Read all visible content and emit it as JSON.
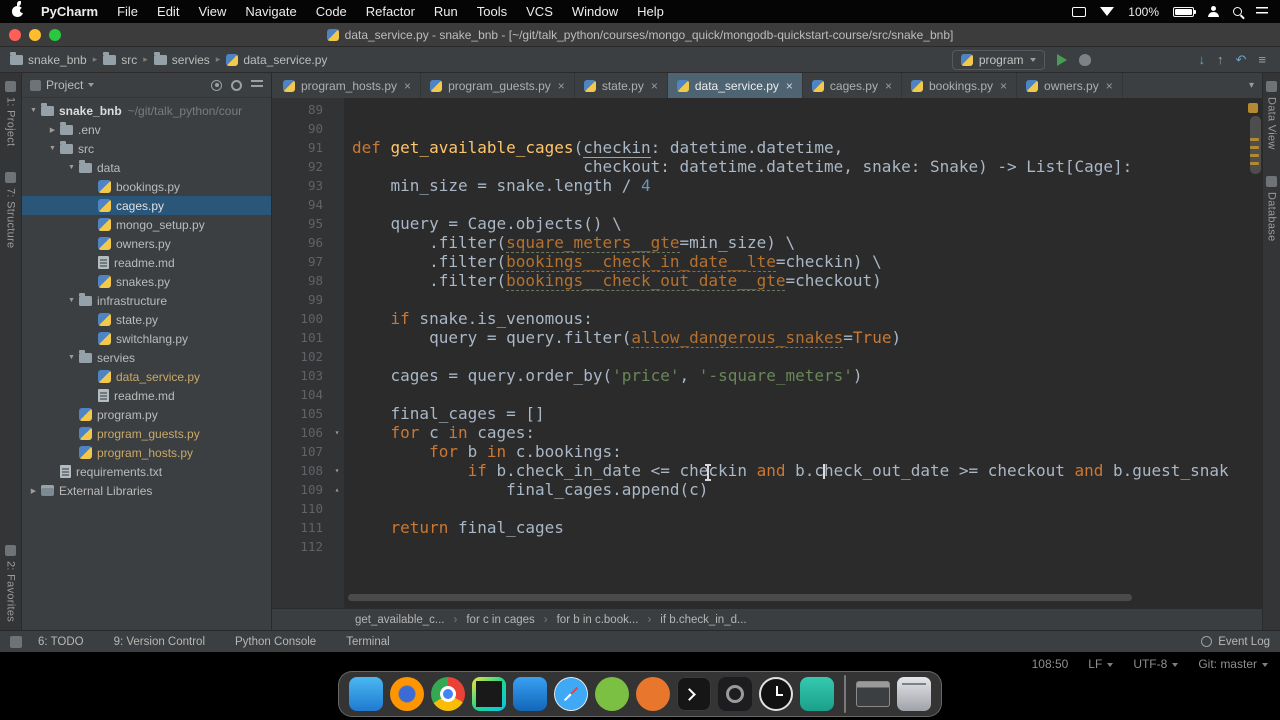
{
  "menubar": {
    "items": [
      "PyCharm",
      "File",
      "Edit",
      "View",
      "Navigate",
      "Code",
      "Refactor",
      "Run",
      "Tools",
      "VCS",
      "Window",
      "Help"
    ],
    "battery": "100%"
  },
  "titlebar": {
    "title": "data_service.py - snake_bnb - [~/git/talk_python/courses/mongo_quick/mongodb-quickstart-course/src/snake_bnb]"
  },
  "navbar": {
    "breadcrumbs": [
      {
        "label": "snake_bnb",
        "icon": "folder"
      },
      {
        "label": "src",
        "icon": "folder"
      },
      {
        "label": "servies",
        "icon": "folder"
      },
      {
        "label": "data_service.py",
        "icon": "py"
      }
    ],
    "run_config": "program"
  },
  "stripes": {
    "left": [
      {
        "label": "1: Project",
        "pos": "top"
      },
      {
        "label": "7: Structure",
        "pos": "top"
      },
      {
        "label": "2: Favorites",
        "pos": "bottom"
      }
    ],
    "right": [
      {
        "label": "Data View"
      },
      {
        "label": "Database"
      }
    ]
  },
  "project": {
    "header": "Project",
    "tree": [
      {
        "label": "snake_bnb",
        "path": "~/git/talk_python/cour",
        "level": 0,
        "icon": "folder",
        "arrow": "open",
        "bold": true
      },
      {
        "label": ".env",
        "level": 1,
        "icon": "folder",
        "arrow": "closed"
      },
      {
        "label": "src",
        "level": 1,
        "icon": "folder",
        "arrow": "open"
      },
      {
        "label": "data",
        "level": 2,
        "icon": "folder",
        "arrow": "open"
      },
      {
        "label": "bookings.py",
        "level": 3,
        "icon": "py"
      },
      {
        "label": "cages.py",
        "level": 3,
        "icon": "py",
        "selected": true
      },
      {
        "label": "mongo_setup.py",
        "level": 3,
        "icon": "py"
      },
      {
        "label": "owners.py",
        "level": 3,
        "icon": "py"
      },
      {
        "label": "readme.md",
        "level": 3,
        "icon": "file"
      },
      {
        "label": "snakes.py",
        "level": 3,
        "icon": "py"
      },
      {
        "label": "infrastructure",
        "level": 2,
        "icon": "folder",
        "arrow": "open"
      },
      {
        "label": "state.py",
        "level": 3,
        "icon": "py"
      },
      {
        "label": "switchlang.py",
        "level": 3,
        "icon": "py"
      },
      {
        "label": "servies",
        "level": 2,
        "icon": "folder",
        "arrow": "open"
      },
      {
        "label": "data_service.py",
        "level": 3,
        "icon": "py",
        "modified": true
      },
      {
        "label": "readme.md",
        "level": 3,
        "icon": "file"
      },
      {
        "label": "program.py",
        "level": 2,
        "icon": "py"
      },
      {
        "label": "program_guests.py",
        "level": 2,
        "icon": "py",
        "modified": true
      },
      {
        "label": "program_hosts.py",
        "level": 2,
        "icon": "py",
        "modified": true
      },
      {
        "label": "requirements.txt",
        "level": 1,
        "icon": "file"
      },
      {
        "label": "External Libraries",
        "level": 0,
        "icon": "lib",
        "arrow": "closed"
      }
    ]
  },
  "tabs": {
    "active": 3,
    "items": [
      {
        "label": "program_hosts.py"
      },
      {
        "label": "program_guests.py"
      },
      {
        "label": "state.py"
      },
      {
        "label": "data_service.py"
      },
      {
        "label": "cages.py"
      },
      {
        "label": "bookings.py"
      },
      {
        "label": "owners.py"
      }
    ]
  },
  "editor": {
    "lines": [
      {
        "n": 89,
        "t": []
      },
      {
        "n": 90,
        "t": []
      },
      {
        "n": 91,
        "t": [
          [
            "k",
            "def "
          ],
          [
            "f",
            "get_available_cages"
          ],
          [
            "p",
            "("
          ],
          [
            "u",
            "checkin"
          ],
          [
            "p",
            ": datetime.datetime,"
          ]
        ]
      },
      {
        "n": 92,
        "t": [
          [
            "p",
            "                        checkout: datetime.datetime, snake: Snake) -> List[Cage]:"
          ]
        ]
      },
      {
        "n": 93,
        "t": [
          [
            "p",
            "    min_size = snake.length / "
          ],
          [
            "n",
            "4"
          ]
        ]
      },
      {
        "n": 94,
        "t": []
      },
      {
        "n": 95,
        "t": [
          [
            "p",
            "    query = Cage.objects() \\"
          ]
        ]
      },
      {
        "n": 96,
        "t": [
          [
            "p",
            "        .filter("
          ],
          [
            "q",
            "square_meters__gte"
          ],
          [
            "p",
            "=min_size) \\"
          ]
        ]
      },
      {
        "n": 97,
        "t": [
          [
            "p",
            "        .filter("
          ],
          [
            "q",
            "bookings__check_in_date__lte"
          ],
          [
            "p",
            "=checkin) \\"
          ]
        ]
      },
      {
        "n": 98,
        "t": [
          [
            "p",
            "        .filter("
          ],
          [
            "q",
            "bookings__check_out_date__gte"
          ],
          [
            "p",
            "=checkout)"
          ]
        ]
      },
      {
        "n": 99,
        "t": []
      },
      {
        "n": 100,
        "t": [
          [
            "p",
            "    "
          ],
          [
            "k",
            "if"
          ],
          [
            "p",
            " snake.is_venomous:"
          ]
        ]
      },
      {
        "n": 101,
        "t": [
          [
            "p",
            "        query = query.filter("
          ],
          [
            "q",
            "allow_dangerous_snakes"
          ],
          [
            "p",
            "="
          ],
          [
            "k",
            "True"
          ],
          [
            "p",
            ")"
          ]
        ]
      },
      {
        "n": 102,
        "t": []
      },
      {
        "n": 103,
        "t": [
          [
            "p",
            "    cages = query.order_by("
          ],
          [
            "s",
            "'price'"
          ],
          [
            "p",
            ", "
          ],
          [
            "s",
            "'-square_meters'"
          ],
          [
            "p",
            ")"
          ]
        ]
      },
      {
        "n": 104,
        "t": []
      },
      {
        "n": 105,
        "t": [
          [
            "p",
            "    final_cages = []"
          ]
        ]
      },
      {
        "n": 106,
        "fold": "v",
        "t": [
          [
            "p",
            "    "
          ],
          [
            "k",
            "for"
          ],
          [
            "p",
            " c "
          ],
          [
            "k",
            "in"
          ],
          [
            "p",
            " cages:"
          ]
        ]
      },
      {
        "n": 107,
        "t": [
          [
            "p",
            "        "
          ],
          [
            "k",
            "for"
          ],
          [
            "p",
            " b "
          ],
          [
            "k",
            "in"
          ],
          [
            "p",
            " c.bookings:"
          ]
        ]
      },
      {
        "n": 108,
        "fold": "v",
        "t": [
          [
            "p",
            "            "
          ],
          [
            "k",
            "if"
          ],
          [
            "p",
            " b.check_in_date <= checkin "
          ],
          [
            "k",
            "and"
          ],
          [
            "p",
            " b.c"
          ],
          [
            "c",
            ""
          ],
          [
            "p",
            "heck_out_date >= checkout "
          ],
          [
            "k",
            "and"
          ],
          [
            "p",
            " b.guest_snak"
          ]
        ]
      },
      {
        "n": 109,
        "fold": "^",
        "t": [
          [
            "p",
            "                final_cages.append(c)"
          ]
        ]
      },
      {
        "n": 110,
        "t": []
      },
      {
        "n": 111,
        "t": [
          [
            "p",
            "    "
          ],
          [
            "k",
            "return"
          ],
          [
            "p",
            " final_cages"
          ]
        ]
      },
      {
        "n": 112,
        "t": []
      }
    ]
  },
  "crumbs": [
    "get_available_c...",
    "for c in cages",
    "for b in c.book...",
    "if b.check_in_d..."
  ],
  "statusbar": {
    "left": [
      "6: TODO",
      "9: Version Control",
      "Python Console",
      "Terminal"
    ],
    "right": "Event Log"
  },
  "status2": [
    {
      "label": "108:50",
      "chevron": false
    },
    {
      "label": "LF",
      "chevron": true
    },
    {
      "label": "UTF-8",
      "chevron": true
    },
    {
      "label": "Git: master",
      "chevron": true
    }
  ],
  "dock": {
    "items": [
      {
        "name": "finder"
      },
      {
        "name": "firefox"
      },
      {
        "name": "chrome"
      },
      {
        "name": "pycharm"
      },
      {
        "name": "vscode"
      },
      {
        "name": "safari"
      },
      {
        "name": "android-studio"
      },
      {
        "name": "utilities"
      },
      {
        "name": "terminal"
      },
      {
        "name": "gauge"
      },
      {
        "name": "clock"
      },
      {
        "name": "notes"
      },
      {
        "name": "separator"
      },
      {
        "name": "minimized-window"
      },
      {
        "name": "trash"
      }
    ]
  },
  "colors": {
    "run_green": "#499C54",
    "selection_blue": "#2a567a",
    "modified_file_gold": "#c9a969",
    "keyword_orange": "#cc7832",
    "editor_bg": "#2b2b2b"
  }
}
